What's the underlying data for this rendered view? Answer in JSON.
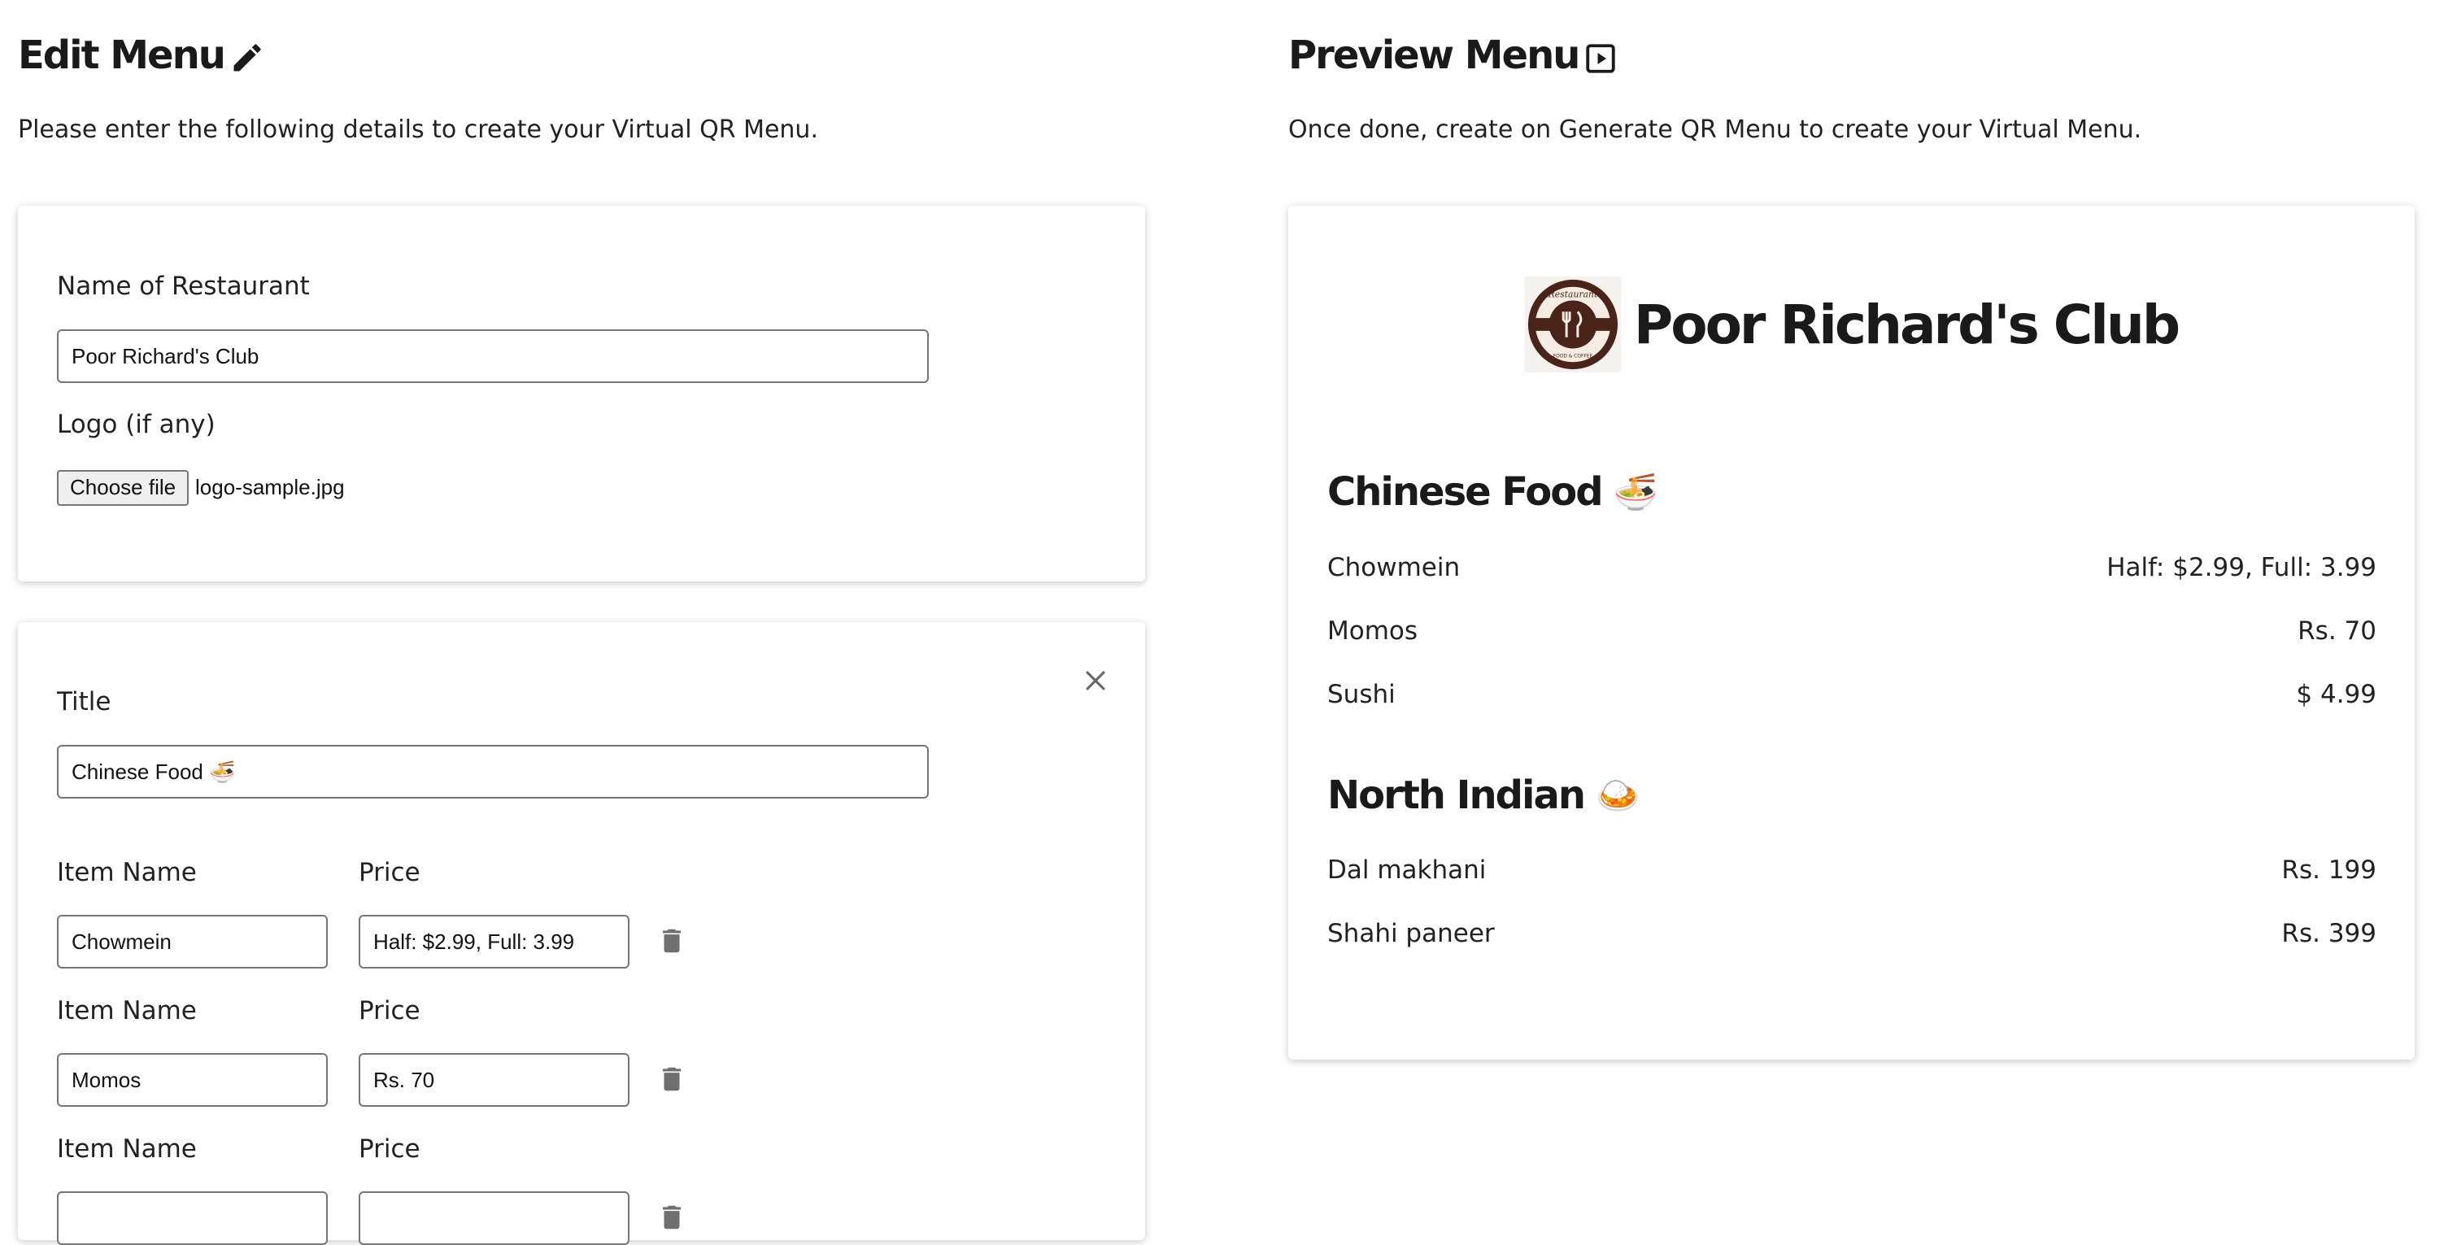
{
  "edit": {
    "heading": "Edit Menu",
    "subtitle": "Please enter the following details to create your Virtual QR Menu.",
    "restaurant_label": "Name of Restaurant",
    "restaurant_value": "Poor Richard's Club",
    "logo_label": "Logo (if any)",
    "file_button": "Choose file",
    "file_name": "logo-sample.jpg"
  },
  "section_form": {
    "title_label": "Title",
    "title_value": "Chinese Food 🍜",
    "item_name_label": "Item Name",
    "price_label": "Price",
    "items": [
      {
        "name": "Chowmein",
        "price": "Half: $2.99, Full: 3.99"
      },
      {
        "name": "Momos",
        "price": "Rs. 70"
      },
      {
        "name": "",
        "price": ""
      }
    ]
  },
  "preview": {
    "heading": "Preview Menu",
    "subtitle": "Once done, create on Generate QR Menu to create your Virtual Menu.",
    "restaurant_name": "Poor Richard's Club",
    "logo_text_top": "Restaurant",
    "logo_text_bottom": "FOOD & COFFEE",
    "sections": [
      {
        "title": "Chinese Food",
        "emoji": "🍜",
        "items": [
          {
            "name": "Chowmein",
            "price": "Half: $2.99, Full: 3.99"
          },
          {
            "name": "Momos",
            "price": "Rs. 70"
          },
          {
            "name": "Sushi",
            "price": "$ 4.99"
          }
        ]
      },
      {
        "title": "North Indian",
        "emoji": "🍛",
        "items": [
          {
            "name": "Dal makhani",
            "price": "Rs. 199"
          },
          {
            "name": "Shahi paneer",
            "price": "Rs. 399"
          }
        ]
      }
    ]
  },
  "icons": [
    "pencil-icon",
    "play-box-icon",
    "close-icon",
    "trash-icon"
  ],
  "colors": {
    "text": "#1a1a1a",
    "icon_gray": "#757575",
    "logo_brown": "#4a2418"
  }
}
